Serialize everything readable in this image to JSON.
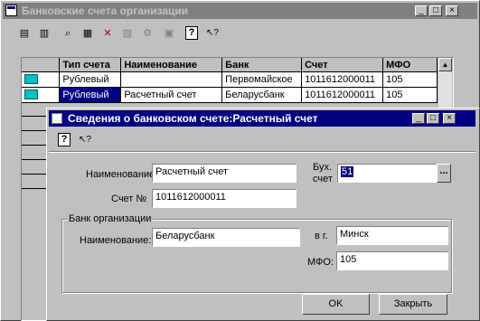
{
  "main_window": {
    "title": "Банковские счета организации",
    "toolbar_icons": [
      "new-icon",
      "copy-icon",
      "find-icon",
      "add-icon",
      "delete-icon",
      "move-icon",
      "tree-icon",
      "paste-icon",
      "help-icon",
      "whatsthis-icon"
    ],
    "table": {
      "headers": [
        "Тип счета",
        "Наименование",
        "Банк",
        "Счет",
        "МФО"
      ],
      "rows": [
        [
          "Рублевый",
          "",
          "Первомайское",
          "1011612000011",
          "105"
        ],
        [
          "Рублевый",
          "Расчетный счет",
          "Беларусбанк",
          "1011612000011",
          "105"
        ]
      ]
    }
  },
  "dialog": {
    "title": "Сведения о банковском счете:Расчетный счет",
    "name_label": "Наименование:",
    "name_value": "Расчетный счет",
    "acc_label": "Счет №",
    "acc_value": "1011612000011",
    "buh_label_1": "Бух.",
    "buh_label_2": "счет",
    "buh_value": "51",
    "ellipsis": "...",
    "group_title": "Банк организации",
    "bank_name_label": "Наименование:",
    "bank_name_value": "Беларусбанк",
    "city_label": "в г.",
    "city_value": "Минск",
    "mfo_label": "МФО:",
    "mfo_value": "105",
    "ok_label": "OK",
    "close_label": "Закрыть"
  },
  "window_buttons": {
    "minimize": "_",
    "maximize": "□",
    "close": "×"
  },
  "help_glyph": "?",
  "whatsthis_glyph": "↖?",
  "scroll_up_glyph": "▲"
}
